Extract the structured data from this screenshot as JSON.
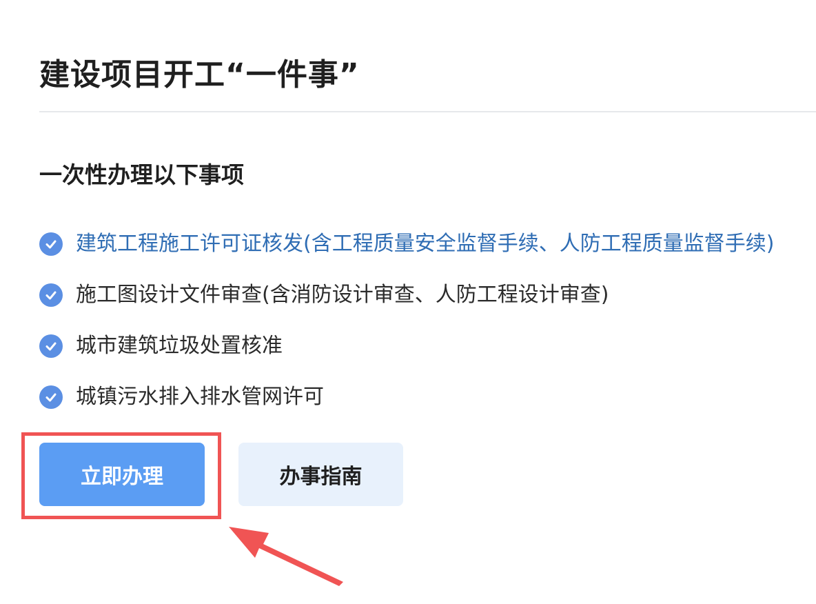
{
  "header": {
    "title": "建设项目开工“一件事”"
  },
  "section": {
    "title": "一次性办理以下事项"
  },
  "items": [
    {
      "label": "建筑工程施工许可证核发(含工程质量安全监督手续、人防工程质量监督手续)",
      "is_link": true
    },
    {
      "label": "施工图设计文件审查(含消防设计审查、人防工程设计审查)",
      "is_link": false
    },
    {
      "label": "城市建筑垃圾处置核准",
      "is_link": false
    },
    {
      "label": "城镇污水排入排水管网许可",
      "is_link": false
    }
  ],
  "actions": {
    "apply_label": "立即办理",
    "guide_label": "办事指南"
  },
  "colors": {
    "primary": "#5b9df3",
    "secondary_bg": "#e8f1fc",
    "check": "#5b8fe3",
    "link": "#2f6db4",
    "annotation": "#f05454"
  },
  "icons": {
    "check": "check-circle-icon",
    "annotation": "arrow-pointer-icon"
  }
}
